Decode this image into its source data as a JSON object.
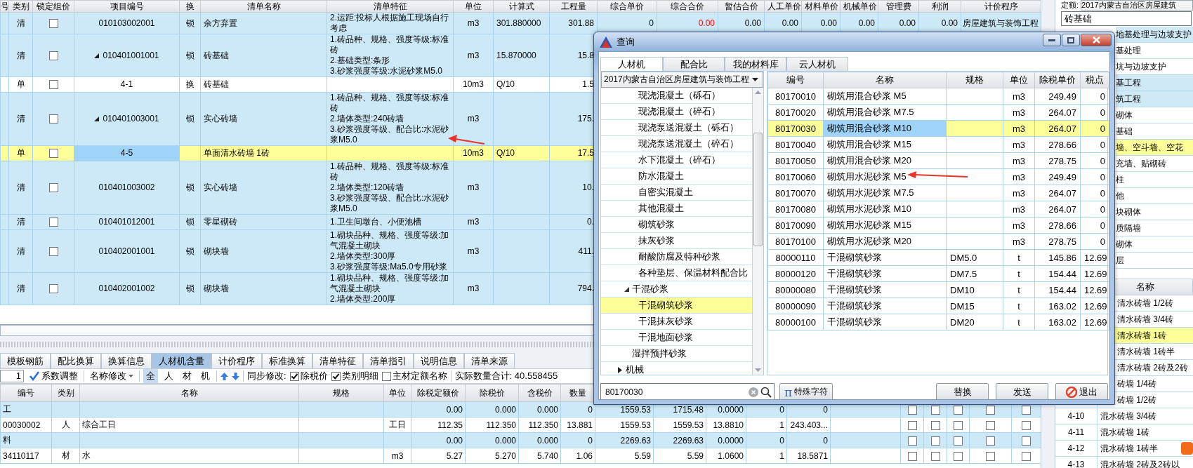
{
  "main_table": {
    "columns": [
      "号",
      "类别",
      "锁定组价",
      "项目编号",
      "换",
      "清单名称",
      "清单特征",
      "单位",
      "计算式",
      "工程量",
      "综合单价",
      "综合合价",
      "暂估合价",
      "人工单价",
      "材料单价",
      "机械单价",
      "管理费",
      "利润",
      "计价程序"
    ],
    "rows": [
      {
        "kind": "bill",
        "selected": false,
        "type": "清",
        "locked": false,
        "code": "010103002001",
        "swap": "锁",
        "name": "余方弃置",
        "features": [
          "2.运距:投标人根据施工现场自行考虑"
        ],
        "unit": "m3",
        "formula": "301.880000",
        "quantity": "301.88",
        "extra": [
          {
            "text": "0",
            "warning": false
          },
          {
            "text": "0.00",
            "warning": true
          },
          {
            "text": "0.00",
            "warning": false
          },
          {
            "text": "0.00",
            "warning": false
          },
          {
            "text": "0.00",
            "warning": false
          },
          {
            "text": "0.00",
            "warning": false
          },
          {
            "text": "0.00",
            "warning": false
          },
          {
            "text": "0.00",
            "warning": false
          },
          {
            "text": "房屋建筑与装饰工程",
            "warning": false
          }
        ]
      },
      {
        "kind": "bill",
        "selected": false,
        "type": "清",
        "locked": false,
        "expanded": true,
        "code": "010401001001",
        "swap": "锁",
        "name": "砖基础",
        "features": [
          "1.砖品种、规格、强度等级:标准砖",
          "2.基础类型:条形",
          "3.砂浆强度等级:水泥砂浆M5.0"
        ],
        "unit": "m3",
        "formula": "15.870000",
        "quantity": "15.8"
      },
      {
        "kind": "quota",
        "selected": false,
        "type": "单",
        "locked": false,
        "code": "4-1",
        "swap": "换",
        "name": "砖基础",
        "unit": "10m3",
        "formula": "Q/10",
        "quantity": "1.5"
      },
      {
        "kind": "bill",
        "selected": false,
        "type": "清",
        "locked": false,
        "expanded": true,
        "code": "010401003001",
        "swap": "锁",
        "name": "实心砖墙",
        "features": [
          "1.砖品种、规格、强度等级:标准砖",
          "2.墙体类型:240砖墙",
          "3.砂浆强度等级、配合比:水泥砂浆M5.0"
        ],
        "unit": "m3",
        "quantity": "175."
      },
      {
        "selected": true,
        "type": "单",
        "locked": false,
        "code": "4-5",
        "name": "单面清水砖墙 1砖",
        "unit": "10m3",
        "formula": "Q/10",
        "quantity": "17.5"
      },
      {
        "kind": "bill",
        "selected": false,
        "type": "清",
        "locked": false,
        "code": "010401003002",
        "swap": "锁",
        "name": "实心砖墙",
        "features": [
          "1.砖品种、规格、强度等级:标准砖",
          "2.墙体类型:120砖墙",
          "3.砂浆强度等级、配合比:水泥砂浆M5.0"
        ],
        "unit": "m3",
        "quantity": "10."
      },
      {
        "kind": "bill",
        "selected": false,
        "type": "清",
        "locked": false,
        "code": "010401012001",
        "swap": "锁",
        "name": "零星砌砖",
        "features": [
          "1.卫生间墩台、小便池槽"
        ],
        "unit": "m3",
        "quantity": "0."
      },
      {
        "kind": "bill",
        "selected": false,
        "type": "清",
        "locked": false,
        "code": "010402001001",
        "swap": "锁",
        "name": "砌块墙",
        "features": [
          "1.砌块品种、规格、强度等级:加气混凝土砌块",
          "2.墙体类型:300厚",
          "3.砂浆强度等级:Ma5.0专用砂浆"
        ],
        "unit": "m3",
        "quantity": "411."
      },
      {
        "kind": "bill",
        "selected": false,
        "type": "清",
        "locked": false,
        "code": "010402001002",
        "swap": "锁",
        "name": "砌块墙",
        "features": [
          "1.砌块品种、规格、强度等级:加气混凝土砌块",
          "2.墙体类型:200厚"
        ],
        "unit": "m3",
        "quantity": "794."
      }
    ]
  },
  "detail_tabs": [
    {
      "label": "模板钢筋",
      "selected": false
    },
    {
      "label": "配比换算",
      "selected": false
    },
    {
      "label": "换算信息",
      "selected": false
    },
    {
      "label": "人材机含量",
      "selected": true
    },
    {
      "label": "计价程序",
      "selected": false
    },
    {
      "label": "标准换算",
      "selected": false
    },
    {
      "label": "清单特征",
      "selected": false
    },
    {
      "label": "清单指引",
      "selected": false
    },
    {
      "label": "说明信息",
      "selected": false
    },
    {
      "label": "清单来源",
      "selected": false
    }
  ],
  "toolbar": {
    "factor": "1",
    "factor_button": "系数调整",
    "rename_menu": "名称修改",
    "filters": [
      {
        "label": "全",
        "selected": true
      },
      {
        "label": "人",
        "selected": false
      },
      {
        "label": "材",
        "selected": false
      },
      {
        "label": "机",
        "selected": false
      }
    ],
    "sync_label": "同步修改:",
    "options": [
      {
        "label": "除税价",
        "checked": true
      },
      {
        "label": "类别明细",
        "checked": true
      },
      {
        "label": "主材定额名称",
        "checked": false
      }
    ],
    "total": "实际数量合计: 40.558455"
  },
  "detail_table": {
    "columns": [
      "编号",
      "类别",
      "名称",
      "规格",
      "单位",
      "除税定额价",
      "除税价",
      "含税价",
      "数量"
    ],
    "rows": [
      {
        "kind": "group",
        "code": "工",
        "base_price": "0.00",
        "price": "0.000",
        "tax_price": "0.000",
        "quantity": "0",
        "column_10": "1559.53",
        "column_11": "1715.48",
        "column_12": "0.0000",
        "column_13": "0",
        "column_14": "0",
        "checks": [
          false,
          false,
          false,
          false,
          false
        ]
      },
      {
        "kind": "item",
        "code": "00030002",
        "type": "人",
        "name": "综合工日",
        "unit": "工日",
        "base_price": "112.35",
        "price": "112.350",
        "tax_price": "112.350",
        "quantity": "13.881",
        "column_10": "1559.53",
        "column_11": "1559.53",
        "column_12": "13.8810",
        "column_13": "1",
        "column_14": "243.403...",
        "checks": [
          false,
          false,
          false,
          false,
          false
        ]
      },
      {
        "kind": "group",
        "code": "料",
        "base_price": "0.00",
        "price": "0.000",
        "tax_price": "0.000",
        "quantity": "0",
        "column_10": "2269.63",
        "column_11": "2269.63",
        "column_12": "0.0000",
        "column_13": "0",
        "column_14": "0",
        "checks": [
          false,
          false,
          false,
          false,
          false
        ]
      },
      {
        "kind": "item",
        "code": "34110117",
        "type": "材",
        "name": "水",
        "unit": "m3",
        "base_price": "5.27",
        "price": "5.270",
        "tax_price": "5.740",
        "quantity": "1.06",
        "column_10": "5.59",
        "column_11": "5.59",
        "column_12": "1.0600",
        "column_13": "1",
        "column_14": "18.5871",
        "checks": [
          false,
          false,
          false,
          false,
          false
        ]
      }
    ]
  },
  "quota_panel": {
    "label": "定额:",
    "library": "2017内蒙古自治区房屋建筑",
    "search": {
      "value": "砖基础"
    },
    "chapters": [
      {
        "label": "地基处理与边坡支护",
        "kind": "chapter",
        "selected": false
      },
      {
        "label": "基处理",
        "kind": "section",
        "selected": false
      },
      {
        "label": "坑与边坡支护",
        "kind": "section",
        "selected": false
      },
      {
        "label": "基工程",
        "kind": "chapter",
        "selected": false
      },
      {
        "label": "筑工程",
        "kind": "chapter",
        "selected": false
      },
      {
        "label": "砌体",
        "kind": "section",
        "selected": false
      },
      {
        "label": "基础",
        "kind": "section",
        "selected": false
      },
      {
        "label": "墙、空斗墙、空花",
        "selected": true
      },
      {
        "label": "充墙、贴砌砖",
        "kind": "section",
        "selected": false
      },
      {
        "label": "柱",
        "kind": "section",
        "selected": false
      },
      {
        "label": "他",
        "kind": "section",
        "selected": false
      },
      {
        "label": "块砌体",
        "kind": "section",
        "selected": false
      },
      {
        "label": "质隔墙",
        "kind": "section",
        "selected": false
      },
      {
        "label": "砌体",
        "kind": "section",
        "selected": false
      },
      {
        "label": "层",
        "kind": "section",
        "selected": false
      }
    ],
    "name_header": "名称",
    "items": [
      {
        "name": "清水砖墙 1/2砖",
        "selected": false
      },
      {
        "name": "清水砖墙 3/4砖",
        "selected": false
      },
      {
        "name": "清水砖墙 1砖",
        "selected": true
      },
      {
        "name": "清水砖墙 1砖半",
        "selected": false
      },
      {
        "name": "清水砖墙 2砖及2砖",
        "selected": false
      },
      {
        "name": "砖墙 1/4砖",
        "selected": false
      },
      {
        "name": "砖墙 1/2砖",
        "selected": false
      },
      {
        "code": "4-10",
        "name": "混水砖墙 3/4砖",
        "selected": false
      },
      {
        "code": "4-11",
        "name": "混水砖墙 1砖",
        "selected": false
      },
      {
        "code": "4-12",
        "name": "混水砖墙 1砖半",
        "selected": false
      },
      {
        "code": "4-13",
        "name": "混水砖墙 2砖及2砖以",
        "selected": false
      }
    ]
  },
  "dialog": {
    "title": "查询",
    "tabs": [
      {
        "label": "人材机",
        "selected": true
      },
      {
        "label": "配合比",
        "selected": false
      },
      {
        "label": "我的材料库",
        "selected": false
      },
      {
        "label": "云人材机",
        "selected": false
      }
    ],
    "library": "2017内蒙古自治区房屋建筑与装饰工程",
    "tree": [
      {
        "children": [
          {
            "children": [
              {
                "label": "现浇混凝土（砾石）",
                "selected": false
              },
              {
                "label": "现浇混凝土（碎石）",
                "selected": false
              },
              {
                "label": "现浇泵送混凝土（砾石）",
                "selected": false
              },
              {
                "label": "现浇泵送混凝土（碎石）",
                "selected": false
              },
              {
                "label": "水下混凝土（碎石）",
                "selected": false
              },
              {
                "label": "防水混凝土",
                "selected": false
              },
              {
                "label": "自密实混凝土",
                "selected": false
              },
              {
                "label": "其他混凝土",
                "selected": false
              },
              {
                "label": "砌筑砂浆",
                "selected": false
              },
              {
                "label": "抹灰砂浆",
                "selected": false
              },
              {
                "label": "耐酸防腐及特种砂浆",
                "selected": false
              },
              {
                "label": "各种垫层、保温材料配合比",
                "selected": false
              }
            ]
          },
          {
            "label": "干混砂浆",
            "expanded": true,
            "selected": false,
            "children": [
              {
                "label": "干混砌筑砂浆",
                "selected": true
              },
              {
                "label": "干混抹灰砂浆",
                "selected": false
              },
              {
                "label": "干混地面砂浆",
                "selected": false
              }
            ]
          },
          {
            "label": "湿拌预拌砂浆",
            "selected": false
          }
        ]
      },
      {
        "label": "机械",
        "expanded": false,
        "selected": false
      }
    ],
    "columns": [
      "编号",
      "名称",
      "规格",
      "单位",
      "除税单价",
      "税点"
    ],
    "rows": [
      {
        "code": "80170010",
        "name": "砌筑用混合砂浆 M5",
        "unit": "m3",
        "price": "249.49",
        "tax": "0",
        "selected": false
      },
      {
        "code": "80170020",
        "name": "砌筑用混合砂浆 M7.5",
        "unit": "m3",
        "price": "264.07",
        "tax": "0",
        "selected": false
      },
      {
        "code": "80170030",
        "name": "砌筑用混合砂浆 M10",
        "unit": "m3",
        "price": "264.07",
        "tax": "0",
        "selected": true
      },
      {
        "code": "80170040",
        "name": "砌筑用混合砂浆 M15",
        "unit": "m3",
        "price": "278.66",
        "tax": "0",
        "selected": false
      },
      {
        "code": "80170050",
        "name": "砌筑用混合砂浆 M20",
        "unit": "m3",
        "price": "278.75",
        "tax": "0",
        "selected": false
      },
      {
        "code": "80170060",
        "name": "砌筑用水泥砂浆 M5",
        "unit": "m3",
        "price": "249.49",
        "tax": "0",
        "selected": false
      },
      {
        "code": "80170070",
        "name": "砌筑用水泥砂浆 M7.5",
        "unit": "m3",
        "price": "264.07",
        "tax": "0",
        "selected": false
      },
      {
        "code": "80170080",
        "name": "砌筑用水泥砂浆 M10",
        "unit": "m3",
        "price": "264.07",
        "tax": "0",
        "selected": false
      },
      {
        "code": "80170090",
        "name": "砌筑用水泥砂浆 M15",
        "unit": "m3",
        "price": "278.66",
        "tax": "0",
        "selected": false
      },
      {
        "code": "80170100",
        "name": "砌筑用水泥砂浆 M20",
        "unit": "m3",
        "price": "278.75",
        "tax": "0",
        "selected": false
      },
      {
        "code": "80000110",
        "name": "干混砌筑砂浆",
        "spec": "DM5.0",
        "unit": "t",
        "price": "145.86",
        "tax": "12.69",
        "selected": false
      },
      {
        "code": "80000120",
        "name": "干混砌筑砂浆",
        "spec": "DM7.5",
        "unit": "t",
        "price": "154.44",
        "tax": "12.69",
        "selected": false
      },
      {
        "code": "80000080",
        "name": "干混砌筑砂浆",
        "spec": "DM10",
        "unit": "t",
        "price": "154.44",
        "tax": "12.69",
        "selected": false
      },
      {
        "code": "80000090",
        "name": "干混砌筑砂浆",
        "spec": "DM15",
        "unit": "t",
        "price": "163.02",
        "tax": "12.69",
        "selected": false
      },
      {
        "code": "80000100",
        "name": "干混砌筑砂浆",
        "spec": "DM20",
        "unit": "t",
        "price": "163.02",
        "tax": "12.69",
        "selected": false
      }
    ],
    "search": {
      "value": "80170030"
    },
    "pi_symbol": "π",
    "special_button": "特殊字符",
    "buttons": [
      {
        "kind": "plain",
        "label": "替换"
      },
      {
        "kind": "plain",
        "label": "发送"
      },
      {
        "kind": "exit",
        "label": "退出"
      }
    ]
  }
}
